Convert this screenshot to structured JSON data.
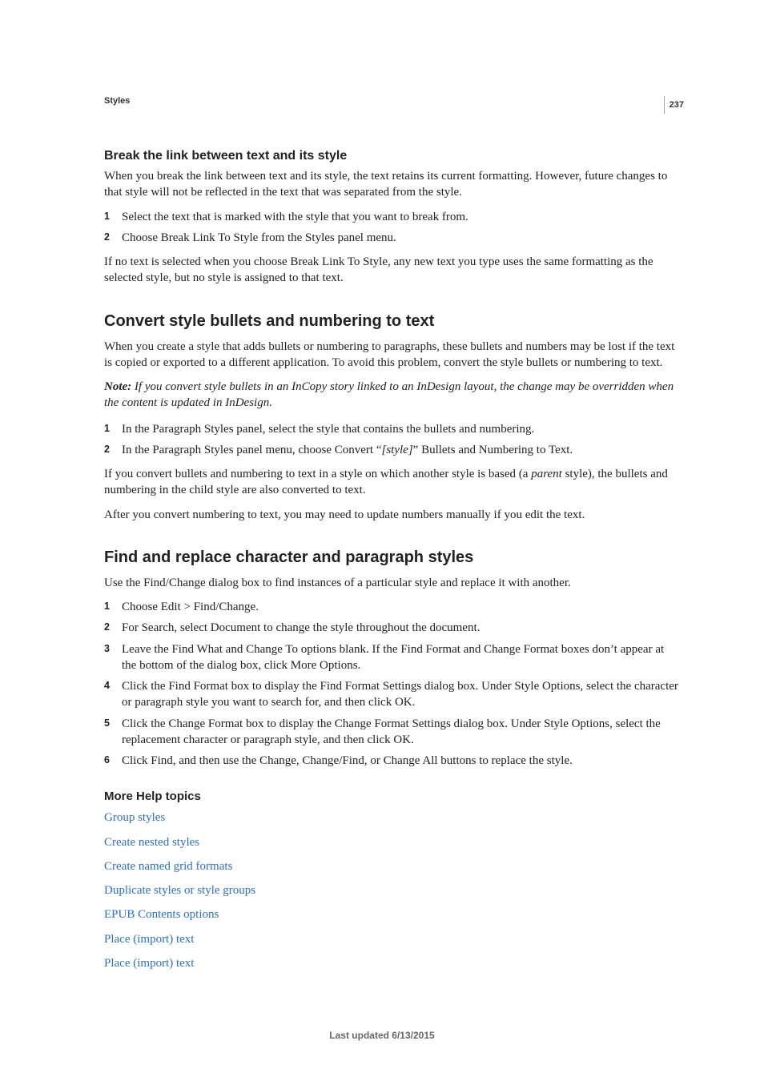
{
  "header": {
    "running_head": "Styles",
    "page_number": "237"
  },
  "sections": {
    "break_link": {
      "heading": "Break the link between text and its style",
      "intro": "When you break the link between text and its style, the text retains its current formatting. However, future changes to that style will not be reflected in the text that was separated from the style.",
      "steps": [
        "Select the text that is marked with the style that you want to break from.",
        "Choose Break Link To Style from the Styles panel menu."
      ],
      "after": "If no text is selected when you choose Break Link To Style, any new text you type uses the same formatting as the selected style, but no style is assigned to that text."
    },
    "convert": {
      "heading": "Convert style bullets and numbering to text",
      "intro": "When you create a style that adds bullets or numbering to paragraphs, these bullets and numbers may be lost if the text is copied or exported to a different application. To avoid this problem, convert the style bullets or numbering to text.",
      "note_label": "Note: ",
      "note_body": "If you convert style bullets in an InCopy story linked to an InDesign layout, the change may be overridden when the content is updated in InDesign.",
      "steps": [
        "In the Paragraph Styles panel, select the style that contains the bullets and numbering."
      ],
      "step2_pre": "In the Paragraph Styles panel menu, choose Convert “",
      "step2_italic": "[style]",
      "step2_post": "” Bullets and Numbering to Text.",
      "after1_pre": "If you convert bullets and numbering to text in a style on which another style is based (a ",
      "after1_italic": "parent",
      "after1_post": " style), the bullets and numbering in the child style are also converted to text.",
      "after2": "After you convert numbering to text, you may need to update numbers manually if you edit the text."
    },
    "find_replace": {
      "heading": "Find and replace character and paragraph styles",
      "intro": "Use the Find/Change dialog box to find instances of a particular style and replace it with another.",
      "steps": [
        "Choose Edit > Find/Change.",
        "For Search, select Document to change the style throughout the document.",
        "Leave the Find What and Change To options blank. If the Find Format and Change Format boxes don’t appear at the bottom of the dialog box, click More Options.",
        "Click the Find Format box to display the Find Format Settings dialog box. Under Style Options, select the character or paragraph style you want to search for, and then click OK.",
        "Click the Change Format box to display the Change Format Settings dialog box. Under Style Options, select the replacement character or paragraph style, and then click OK.",
        "Click Find, and then use the Change, Change/Find, or Change All buttons to replace the style."
      ]
    }
  },
  "more_help": {
    "heading": "More Help topics",
    "links": [
      "Group styles",
      "Create nested styles",
      "Create named grid formats",
      "Duplicate styles or style groups",
      "EPUB Contents options",
      "Place (import) text",
      "Place (import) text"
    ]
  },
  "footer": "Last updated 6/13/2015"
}
